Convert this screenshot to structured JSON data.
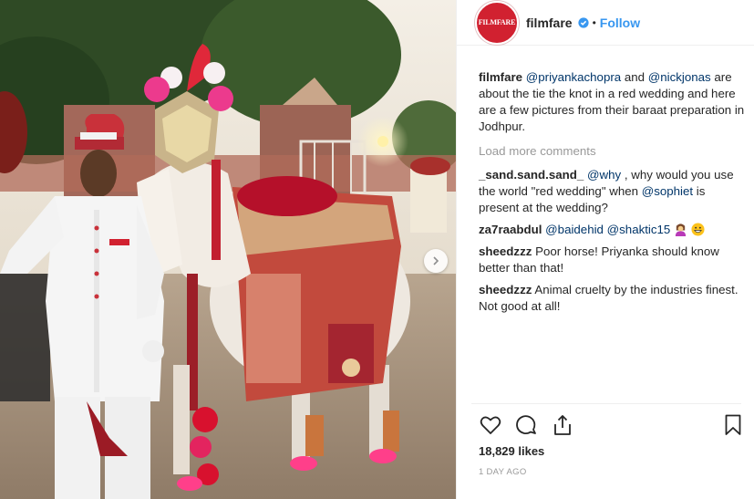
{
  "post": {
    "username": "filmfare",
    "avatar_text": "FILMFARE",
    "separator": "•",
    "follow_label": "Follow",
    "caption": {
      "user": "filmfare",
      "mention1": "@priyankachopra",
      "and": " and ",
      "mention2": "@nickjonas",
      "text": " are about the tie the knot in a red wedding and here are a few pictures from their baraat preparation in Jodhpur."
    },
    "load_more": "Load more comments",
    "comments": [
      {
        "user": "_sand.sand.sand_",
        "mention": "@why",
        "text1": " , why would you use the world \"red wedding\" when ",
        "mention2": "@sophiet",
        "text2": " is present at the wedding?"
      },
      {
        "user": "za7raabdul",
        "mention": "@baidehid",
        "mention2": "@shaktic15",
        "emojis": [
          "woman-gesturing-icon",
          "grinning-face-icon"
        ]
      },
      {
        "user": "sheedzzz",
        "text": " Poor horse! Priyanka should know better than that!"
      },
      {
        "user": "sheedzzz",
        "text": " Animal cruelty by the industries finest. Not good at all!"
      }
    ],
    "likes": "18,829 likes",
    "time": "1 DAY AGO"
  },
  "colors": {
    "link": "#003569",
    "follow": "#3897f0",
    "brand": "#d12130",
    "muted": "#999999"
  },
  "icons": [
    "heart-icon",
    "comment-icon",
    "share-icon",
    "bookmark-icon",
    "verified-badge-icon",
    "next-arrow-icon"
  ]
}
